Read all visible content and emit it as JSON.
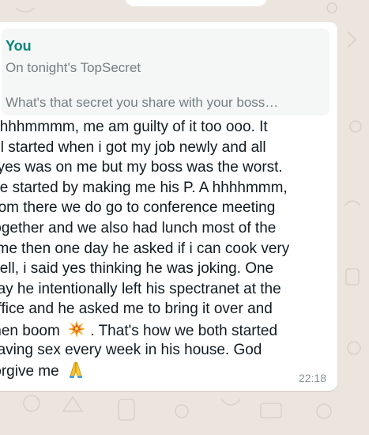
{
  "chat": {
    "quoted": {
      "sender": "You",
      "line1": "On tonight's TopSecret",
      "line2": "What's that secret you share with your boss…"
    },
    "message_lines": [
      "Hhhhmmmm, me am guilty of it too ooo. It",
      "all started when i got my job  newly and all",
      "eyes was on me but my boss was the worst.",
      "He started by making me his P. A hhhhmmm,",
      "from there we do go to conference meeting",
      "together and we also had lunch most of the",
      "time then one day he asked if i can cook very",
      "well, i said yes thinking he was joking. One",
      "day he intentionally left his spectranet at the",
      "office and he asked me to bring it over and",
      "then boom",
      ". That's how we both started",
      "having sex every week in his house. God",
      "forgive me"
    ],
    "time": "22:18",
    "icons": {
      "boom": "collision-emoji-icon",
      "pray": "folded-hands-emoji-icon"
    },
    "colors": {
      "background": "#ece5dd",
      "bubble": "#ffffff",
      "sender": "#06867b"
    }
  }
}
